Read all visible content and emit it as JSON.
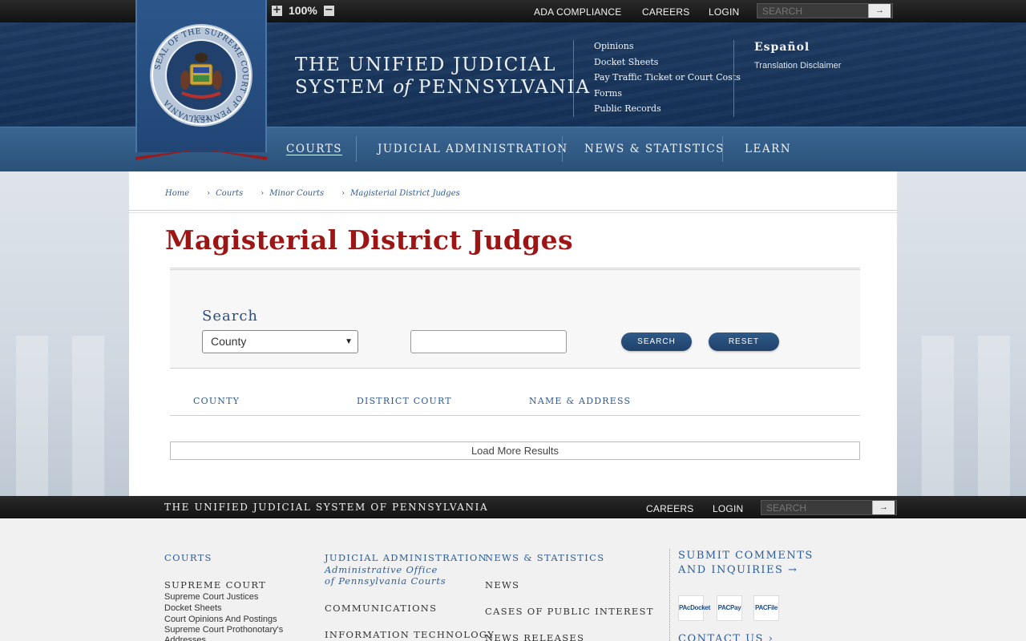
{
  "topbar": {
    "zoom_level": "100%",
    "links": [
      "ADA COMPLIANCE",
      "CAREERS",
      "LOGIN"
    ],
    "search_placeholder": "SEARCH"
  },
  "header": {
    "title_line1": "THE UNIFIED JUDICIAL",
    "title_line2_a": "SYSTEM",
    "title_line2_of": "of",
    "title_line2_b": "PENNSYLVANIA",
    "quick_links": [
      "Opinions",
      "Docket Sheets",
      "Pay Traffic Ticket or Court Costs",
      "Forms",
      "Public Records"
    ],
    "language": "Español",
    "translation": "Translation Disclaimer",
    "seal_text": "SEAL OF THE SUPREME COURT OF PENNSYLVANIA",
    "seal_year": "1722"
  },
  "nav": {
    "items": [
      "COURTS",
      "JUDICIAL ADMINISTRATION",
      "NEWS & STATISTICS",
      "LEARN"
    ],
    "active": "COURTS"
  },
  "breadcrumb": [
    "Home",
    "Courts",
    "Minor Courts",
    "Magisterial District Judges"
  ],
  "page": {
    "title": "Magisterial District Judges",
    "search_label": "Search",
    "select_value": "County",
    "search_button": "SEARCH",
    "reset_button": "RESET",
    "columns": [
      "COUNTY",
      "DISTRICT COURT",
      "NAME & ADDRESS"
    ],
    "load_more": "Load More Results"
  },
  "footer_bar": {
    "title": "THE UNIFIED JUDICIAL SYSTEM OF PENNSYLVANIA",
    "links": [
      "CAREERS",
      "LOGIN"
    ],
    "search_placeholder": "SEARCH"
  },
  "footer": {
    "col1": {
      "heading": "COURTS",
      "subheading": "SUPREME COURT",
      "links": [
        "Supreme Court Justices",
        "Docket Sheets",
        "Court Opinions And Postings",
        "Supreme Court Prothonotary's",
        "Addresses"
      ]
    },
    "col2": {
      "heading": "JUDICIAL ADMINISTRATION",
      "sub1": "Administrative Office",
      "sub2": "of Pennsylvania Courts",
      "items": [
        "COMMUNICATIONS",
        "INFORMATION TECHNOLOGY"
      ]
    },
    "col3": {
      "heading": "NEWS & STATISTICS",
      "items": [
        "NEWS",
        "CASES OF PUBLIC INTEREST",
        "NEWS RELEASES"
      ]
    },
    "col4": {
      "heading": "SUBMIT COMMENTS AND INQUIRIES",
      "apps": [
        "PAcDocket",
        "PACPay",
        "PACFile"
      ],
      "contact": "CONTACT US"
    }
  },
  "colors": {
    "navy": "#1e3a60",
    "nav_blue": "#2a5179",
    "title_red": "#9c1616",
    "link_blue": "#2d5d95"
  }
}
